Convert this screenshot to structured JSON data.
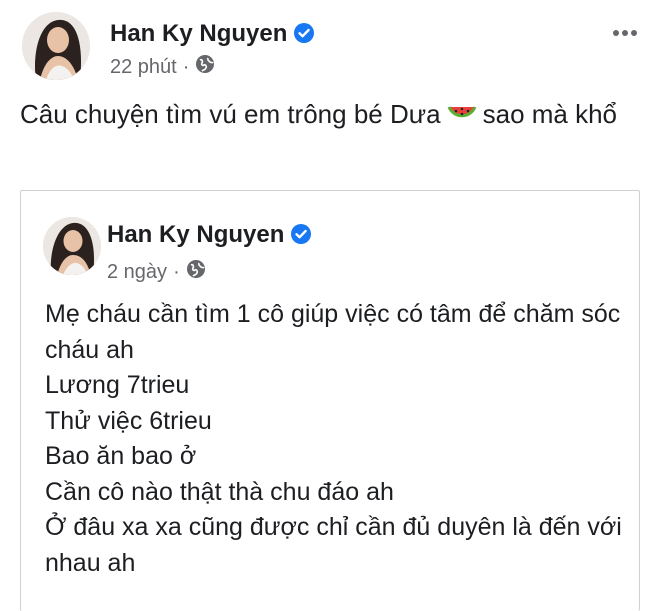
{
  "post": {
    "author": "Han Ky Nguyen",
    "time": "22 phút",
    "separator": "·",
    "text_before_emoji": "Câu chuyện tìm vú em trông bé Dưa",
    "text_after_emoji": "sao mà khổ",
    "icons": {
      "verified": "verified-badge-icon",
      "privacy": "globe-icon",
      "emoji": "watermelon-icon",
      "more": "more-options-icon"
    }
  },
  "shared_post": {
    "author": "Han Ky Nguyen",
    "time": "2 ngày",
    "separator": "·",
    "lines": [
      "Mẹ cháu cần tìm 1 cô giúp việc có tâm để chăm sóc cháu ah",
      "Lương 7trieu",
      "Thử việc 6trieu",
      "Bao ăn bao ở",
      "Cần cô nào thật thà chu đáo ah",
      "Ở đâu xa xa cũng được chỉ cần đủ duyên là đến với nhau ah"
    ]
  },
  "colors": {
    "verified_blue": "#1877f2",
    "meta_gray": "#65676b",
    "text": "#1c1e21",
    "border": "#ced0d4"
  }
}
